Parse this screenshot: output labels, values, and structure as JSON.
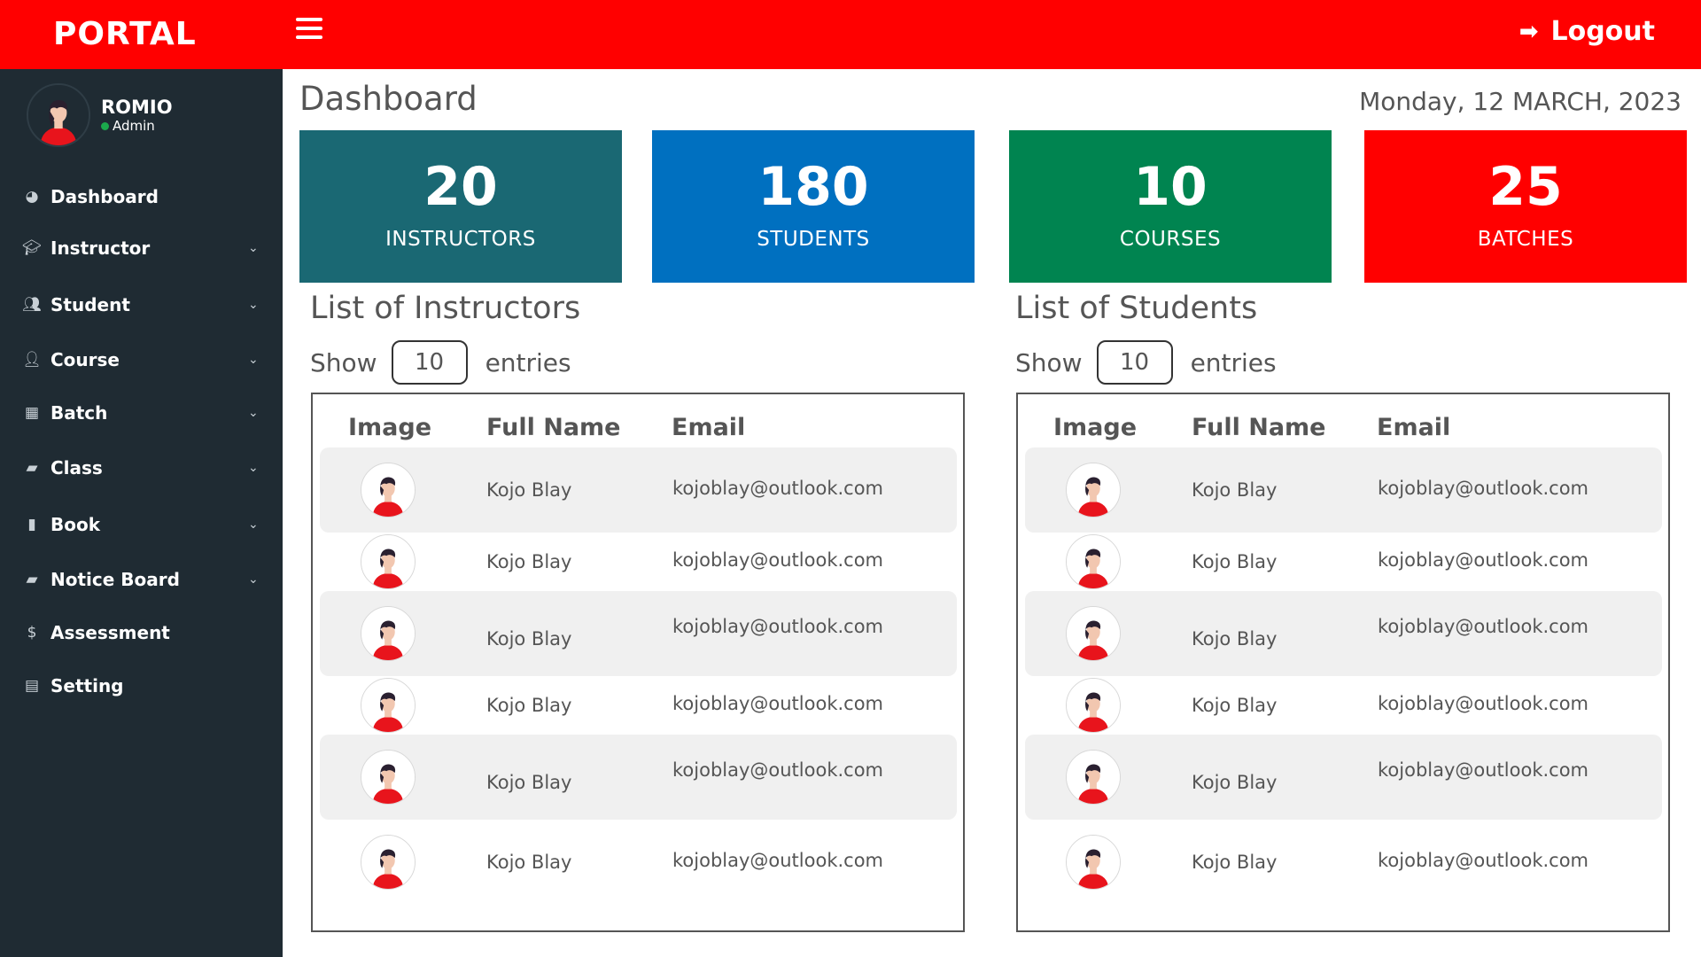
{
  "header": {
    "brand": "PORTAL",
    "logout_label": "Logout"
  },
  "profile": {
    "name": "ROMIO",
    "role": "Admin"
  },
  "sidebar": {
    "items": [
      {
        "label": "Dashboard",
        "icon": "dashboard-icon",
        "has_submenu": false
      },
      {
        "label": "Instructor",
        "icon": "graduation-cap-icon",
        "has_submenu": true
      },
      {
        "label": "Student",
        "icon": "users-icon",
        "has_submenu": true
      },
      {
        "label": "Course",
        "icon": "user-icon",
        "has_submenu": true
      },
      {
        "label": "Batch",
        "icon": "grid-icon",
        "has_submenu": true
      },
      {
        "label": "Class",
        "icon": "note-icon",
        "has_submenu": true
      },
      {
        "label": "Book",
        "icon": "file-icon",
        "has_submenu": true
      },
      {
        "label": "Notice Board",
        "icon": "book-icon",
        "has_submenu": true
      },
      {
        "label": "Assessment",
        "icon": "dollar-icon",
        "has_submenu": false
      },
      {
        "label": "Setting",
        "icon": "id-card-icon",
        "has_submenu": false
      }
    ]
  },
  "main": {
    "title": "Dashboard",
    "date": "Monday, 12 MARCH, 2023"
  },
  "stats": [
    {
      "value": "20",
      "label": "INSTRUCTORS",
      "color": "#1a6873"
    },
    {
      "value": "180",
      "label": "STUDENTS",
      "color": "#0070c0"
    },
    {
      "value": "10",
      "label": "COURSES",
      "color": "#008450"
    },
    {
      "value": "25",
      "label": "BATCHES",
      "color": "#ff0000"
    }
  ],
  "instructors": {
    "title": "List of Instructors",
    "show_label": "Show",
    "entries_value": "10",
    "entries_label": "entries",
    "columns": [
      "Image",
      "Full Name",
      "Email"
    ],
    "rows": [
      {
        "name": "Kojo Blay",
        "email": "kojoblay@outlook.com"
      },
      {
        "name": "Kojo Blay",
        "email": "kojoblay@outlook.com"
      },
      {
        "name": "Kojo Blay",
        "email": "kojoblay@outlook.com"
      },
      {
        "name": "Kojo Blay",
        "email": "kojoblay@outlook.com"
      },
      {
        "name": "Kojo Blay",
        "email": "kojoblay@outlook.com"
      },
      {
        "name": "Kojo Blay",
        "email": "kojoblay@outlook.com"
      }
    ]
  },
  "students": {
    "title": "List of Students",
    "show_label": "Show",
    "entries_value": "10",
    "entries_label": "entries",
    "columns": [
      "Image",
      "Full Name",
      "Email"
    ],
    "rows": [
      {
        "name": "Kojo Blay",
        "email": "kojoblay@outlook.com"
      },
      {
        "name": "Kojo Blay",
        "email": "kojoblay@outlook.com"
      },
      {
        "name": "Kojo Blay",
        "email": "kojoblay@outlook.com"
      },
      {
        "name": "Kojo Blay",
        "email": "kojoblay@outlook.com"
      },
      {
        "name": "Kojo Blay",
        "email": "kojoblay@outlook.com"
      },
      {
        "name": "Kojo Blay",
        "email": "kojoblay@outlook.com"
      }
    ]
  }
}
